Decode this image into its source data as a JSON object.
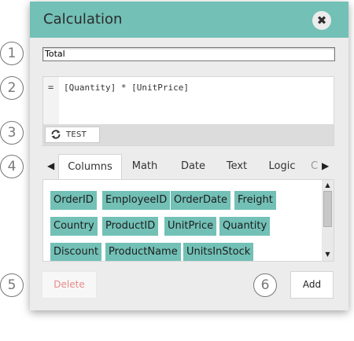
{
  "dialog": {
    "title": "Calculation",
    "close_icon": "close-icon",
    "accent_color": "#72c0b6"
  },
  "callouts": [
    "1",
    "2",
    "3",
    "4",
    "5",
    "6"
  ],
  "name_field": {
    "value": "Total"
  },
  "editor": {
    "prefix": "=",
    "formula": "[Quantity] * [UnitPrice]",
    "test_label": "TEST",
    "test_icon": "refresh-icon"
  },
  "tabs": {
    "items": [
      "Columns",
      "Math",
      "Date",
      "Text",
      "Logic",
      "C"
    ],
    "active": "Columns"
  },
  "fields": [
    "OrderID",
    "EmployeeID",
    "OrderDate",
    "Freight",
    "Country",
    "ProductID",
    "UnitPrice",
    "Quantity",
    "Discount",
    "ProductName",
    "UnitsInStock"
  ],
  "buttons": {
    "delete": "Delete",
    "add": "Add"
  }
}
